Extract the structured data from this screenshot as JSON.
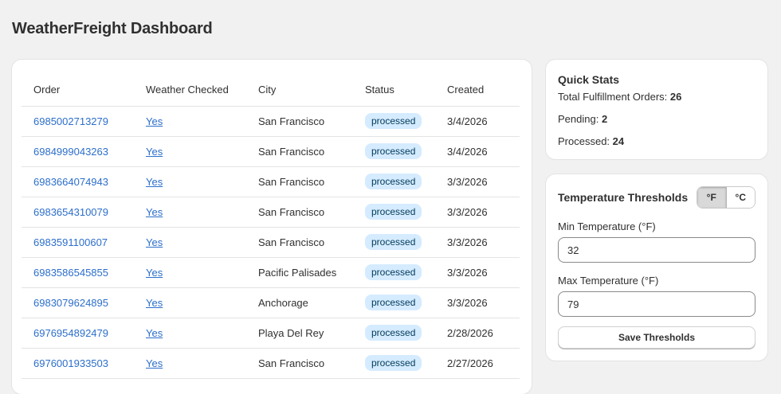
{
  "header": {
    "title": "WeatherFreight Dashboard"
  },
  "orders_table": {
    "columns": [
      "Order",
      "Weather Checked",
      "City",
      "Status",
      "Created"
    ],
    "rows": [
      {
        "order": "6985002713279",
        "weather_checked": "Yes",
        "city": "San Francisco",
        "status": "processed",
        "created": "3/4/2026"
      },
      {
        "order": "6984999043263",
        "weather_checked": "Yes",
        "city": "San Francisco",
        "status": "processed",
        "created": "3/4/2026"
      },
      {
        "order": "6983664074943",
        "weather_checked": "Yes",
        "city": "San Francisco",
        "status": "processed",
        "created": "3/3/2026"
      },
      {
        "order": "6983654310079",
        "weather_checked": "Yes",
        "city": "San Francisco",
        "status": "processed",
        "created": "3/3/2026"
      },
      {
        "order": "6983591100607",
        "weather_checked": "Yes",
        "city": "San Francisco",
        "status": "processed",
        "created": "3/3/2026"
      },
      {
        "order": "6983586545855",
        "weather_checked": "Yes",
        "city": "Pacific Palisades",
        "status": "processed",
        "created": "3/3/2026"
      },
      {
        "order": "6983079624895",
        "weather_checked": "Yes",
        "city": "Anchorage",
        "status": "processed",
        "created": "3/3/2026"
      },
      {
        "order": "6976954892479",
        "weather_checked": "Yes",
        "city": "Playa Del Rey",
        "status": "processed",
        "created": "2/28/2026"
      },
      {
        "order": "6976001933503",
        "weather_checked": "Yes",
        "city": "San Francisco",
        "status": "processed",
        "created": "2/27/2026"
      }
    ]
  },
  "quick_stats": {
    "title": "Quick Stats",
    "total_label": "Total Fulfillment Orders:",
    "total_value": "26",
    "pending_label": "Pending:",
    "pending_value": "2",
    "processed_label": "Processed:",
    "processed_value": "24"
  },
  "thresholds": {
    "title": "Temperature Thresholds",
    "unit_f": "°F",
    "unit_c": "°C",
    "selected_unit": "°F",
    "min_label": "Min Temperature (°F)",
    "min_value": "32",
    "max_label": "Max Temperature (°F)",
    "max_value": "79",
    "save_label": "Save Thresholds"
  },
  "colors": {
    "link": "#2c6ecb",
    "badge_bg": "#d5ebff",
    "badge_text": "#003a5a",
    "page_bg": "#f1f1f1"
  }
}
